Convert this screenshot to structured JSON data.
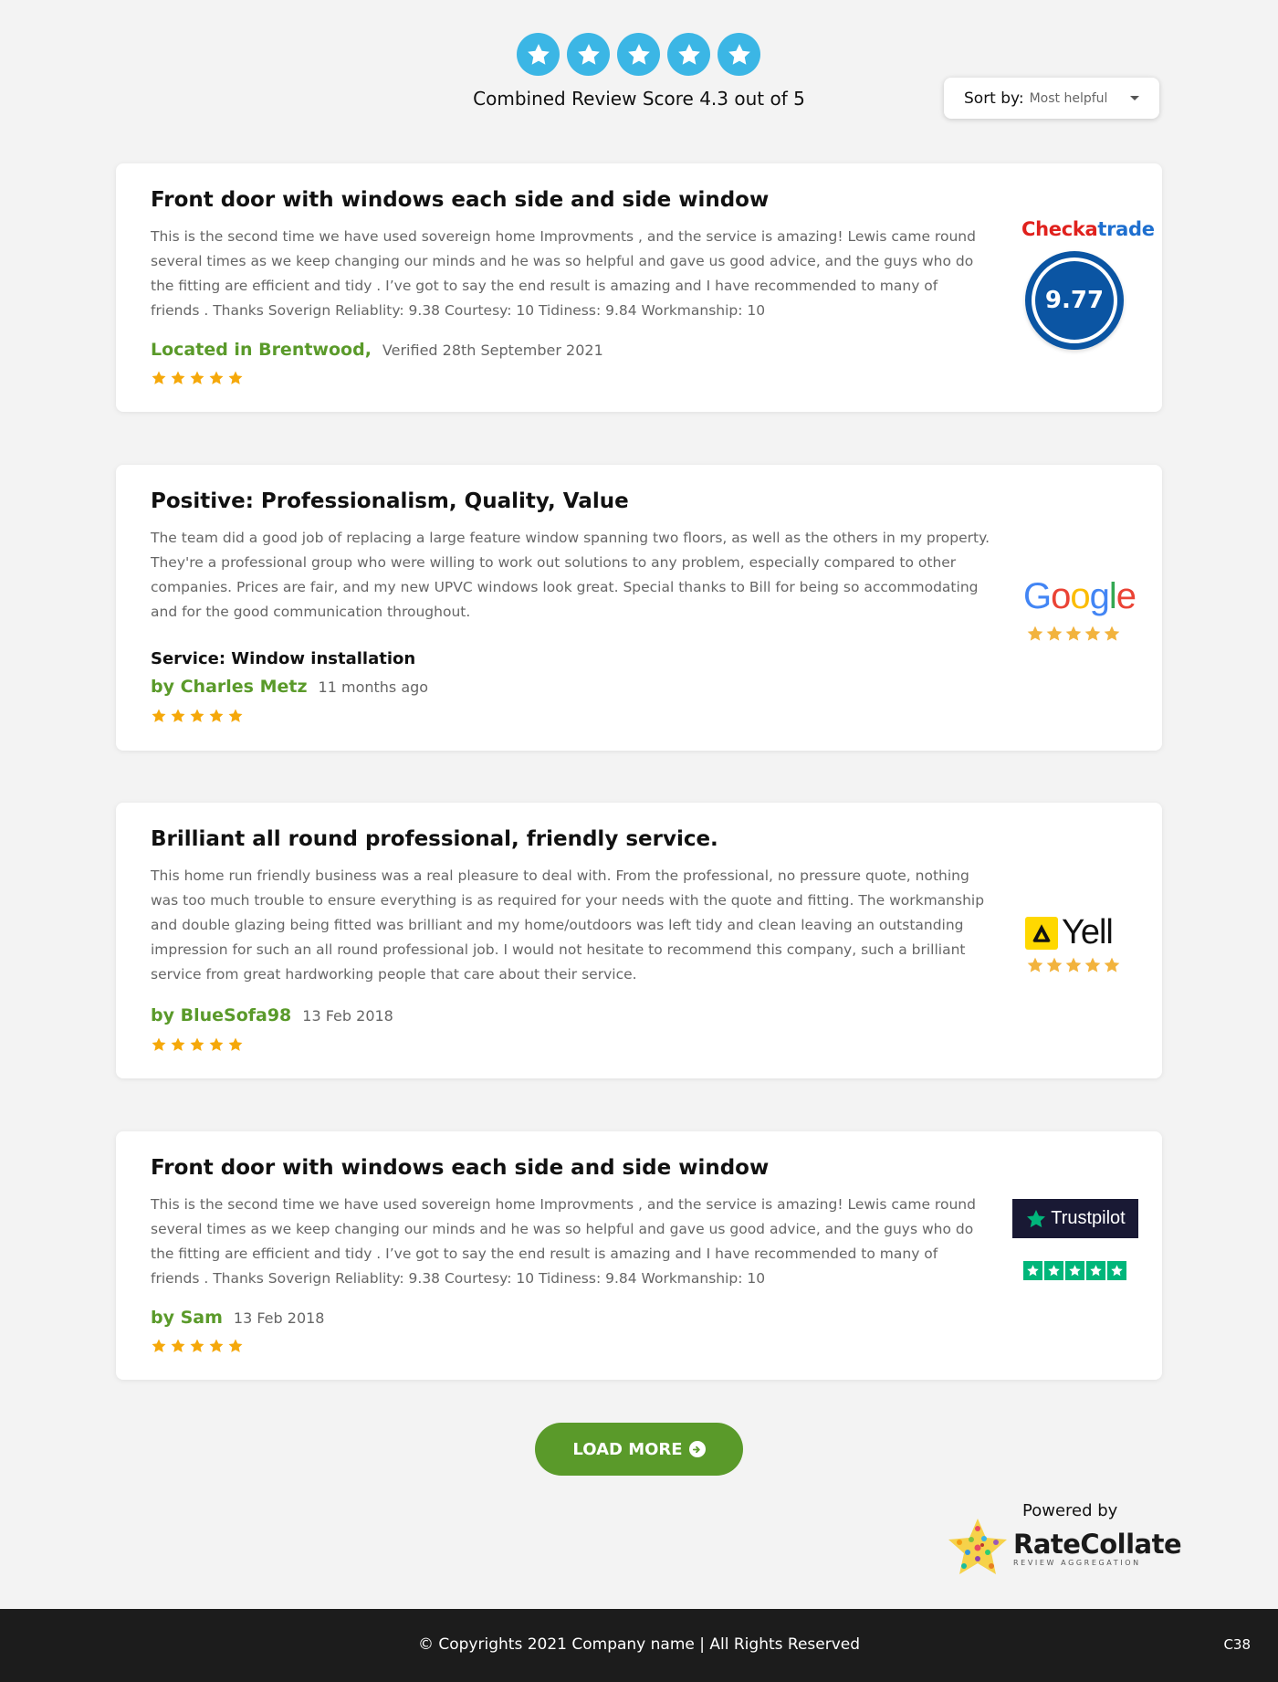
{
  "header": {
    "combined_score_text": "Combined Review Score 4.3 out of 5",
    "score_icon": "star-icon",
    "score_color": "#3bb6e5",
    "sort_label": "Sort by:",
    "sort_value": "Most helpful"
  },
  "reviews": [
    {
      "title": "Front door with windows each side and side window",
      "body": "This is the second time we have used sovereign home Improvments , and the service is amazing! Lewis came round several times as we keep changing our minds and he was so helpful and gave us good advice, and the guys who do the fitting are efficient and tidy . I’ve got to say the end result is amazing and I have recommended to many of friends . Thanks Soverign Reliablity: 9.38 Courtesy: 10 Tidiness: 9.84 Workmanship: 10",
      "author": "Located in Brentwood,",
      "date": "Verified 28th September 2021",
      "rating": 5,
      "source": "checkatrade",
      "source_logo_a": "Checka",
      "source_logo_b": "trade",
      "source_score": "9.77"
    },
    {
      "title": "Positive: Professionalism, Quality, Value",
      "body": "The team did a good job of replacing a large feature window spanning two floors, as well as the others in my property. They're a professional group who were willing to work out solutions to any problem, especially compared to other companies. Prices are fair, and my new UPVC windows look great. Special thanks to Bill for being so accommodating and for the good communication throughout.",
      "service": "Service: Window installation",
      "author": "by Charles Metz",
      "date": "11 months ago",
      "rating": 5,
      "source": "google",
      "source_logo": "Google"
    },
    {
      "title": "Brilliant all round professional, friendly service.",
      "body": "This home run friendly business was a real pleasure to deal with. From the professional, no pressure quote, nothing was too much trouble to ensure everything is as required for your needs with the quote and fitting. The workmanship and double glazing being fitted was brilliant and my home/outdoors was left tidy and clean leaving an outstanding impression for such an all round professional job. I would not hesitate to recommend this company, such a brilliant service from great hardworking people that care about their service.",
      "author": "by BlueSofa98",
      "date": "13 Feb 2018",
      "rating": 5,
      "source": "yell",
      "source_logo": "Yell"
    },
    {
      "title": "Front door with windows each side and side window",
      "body": "This is the second time we have used sovereign home Improvments , and the service is amazing! Lewis came round several times as we keep changing our minds and he was so helpful and gave us good advice, and the guys who do the fitting are efficient and tidy . I’ve got to say the end result is amazing and I have recommended to many of friends . Thanks Soverign Reliablity: 9.38 Courtesy: 10 Tidiness: 9.84 Workmanship: 10",
      "author": "by Sam",
      "date": "13 Feb 2018",
      "rating": 5,
      "source": "trustpilot",
      "source_logo": "Trustpilot"
    }
  ],
  "load_more": {
    "label": "LOAD MORE",
    "icon": "arrow-circle-right-icon"
  },
  "powered_by": {
    "label": "Powered by",
    "brand": "RateCollate",
    "tagline": "REVIEW AGGREGATION"
  },
  "footer": {
    "copyright": "© Copyrights 2021 Company name | All Rights Reserved",
    "code": "C38"
  },
  "colors": {
    "accent_green": "#5a9a2a",
    "star_gold": "#f5a80a",
    "checkatrade_blue": "#0b55a3",
    "trustpilot_green": "#00b67a",
    "footer_bg": "#1c1c1c"
  }
}
